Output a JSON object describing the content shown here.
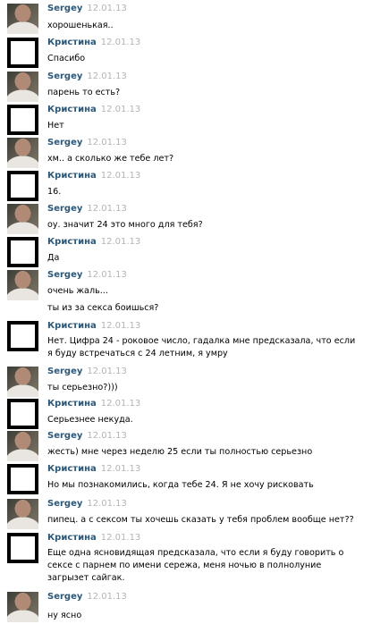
{
  "messages": [
    {
      "author": "Sergey",
      "date": "12.01.13",
      "text": "хорошенькая.."
    },
    {
      "author": "Кристина",
      "date": "12.01.13",
      "text": "Спасибо"
    },
    {
      "author": "Sergey",
      "date": "12.01.13",
      "text": "парень то есть?"
    },
    {
      "author": "Кристина",
      "date": "12.01.13",
      "text": "Нет"
    },
    {
      "author": "Sergey",
      "date": "12.01.13",
      "text": "хм.. а сколько же тебе лет?"
    },
    {
      "author": "Кристина",
      "date": "12.01.13",
      "text": "16."
    },
    {
      "author": "Sergey",
      "date": "12.01.13",
      "text": "оу. значит 24 это много для тебя?"
    },
    {
      "author": "Кристина",
      "date": "12.01.13",
      "text": "Да"
    },
    {
      "author": "Sergey",
      "date": "12.01.13",
      "text": "очень жаль...",
      "text2": "ты из за секса боишься?"
    },
    {
      "author": "Кристина",
      "date": "12.01.13",
      "text": "Нет. Цифра 24 - роковое число, гадалка мне предсказала, что если я буду встречаться с 24 летним, я умру"
    },
    {
      "author": "Sergey",
      "date": "12.01.13",
      "text": "ты серьезно?)))"
    },
    {
      "author": "Кристина",
      "date": "12.01.13",
      "text": "Серьезнее некуда."
    },
    {
      "author": "Sergey",
      "date": "12.01.13",
      "text": "жесть) мне через неделю 25 если ты полностью серьезно"
    },
    {
      "author": "Кристина",
      "date": "12.01.13",
      "text": "Но мы познакомились, когда тебе 24. Я не хочу рисковать"
    },
    {
      "author": "Sergey",
      "date": "12.01.13",
      "text": "пипец. а с сексом ты хочешь сказать у тебя проблем вообще нет??"
    },
    {
      "author": "Кристина",
      "date": "12.01.13",
      "text": "Еще одна ясновидящая предсказала, что если я буду говорить о сексе с парнем по имени сережа, меня ночью в полнолуние загрызет сайгак."
    },
    {
      "author": "Sergey",
      "date": "12.01.13",
      "text": "ну ясно"
    }
  ]
}
